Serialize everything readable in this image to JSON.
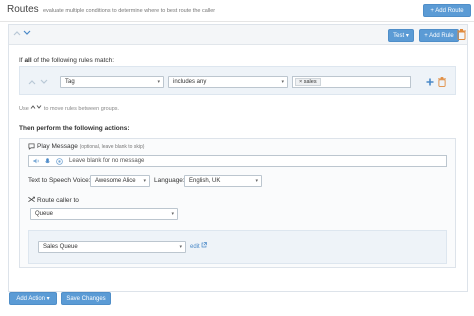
{
  "header": {
    "title": "Routes",
    "subtitle": "evaluate multiple conditions to determine where to best route the caller",
    "add_route_label": "+ Add Route"
  },
  "route": {
    "test_label": "Test ▾",
    "add_rule_label": "+ Add Rule",
    "match_prefix": "If",
    "match_bold": "all",
    "match_suffix": "of the following rules match:",
    "rule": {
      "field": "Tag",
      "operator": "includes any",
      "tag_value": "× sales"
    },
    "hint_pre": "Use",
    "hint_post": "to move rules between groups.",
    "then_label": "Then perform the following actions:",
    "play_message": {
      "label": "Play Message",
      "note": "(optional, leave blank to skip)",
      "placeholder": "Leave blank for no message"
    },
    "tts": {
      "voice_label": "Text to Speech Voice:",
      "voice_value": "Awesome Alice",
      "language_label": "Language:",
      "language_value": "English, UK"
    },
    "route_caller": {
      "label": "Route caller to",
      "target": "Queue",
      "queue": "Sales Queue",
      "edit_label": "edit"
    }
  },
  "footer": {
    "add_action_label": "Add Action ▾",
    "save_label": "Save Changes"
  },
  "colors": {
    "accent": "#5b9bd5",
    "panel_header": "#f4f6f8",
    "rule_bg": "#eef3f8"
  },
  "icons": [
    "chevron-up-icon",
    "chevron-down-icon",
    "trash-icon",
    "add-icon",
    "message-icon",
    "volume-icon",
    "microphone-icon",
    "record-icon",
    "shuffle-icon",
    "external-link-icon"
  ]
}
